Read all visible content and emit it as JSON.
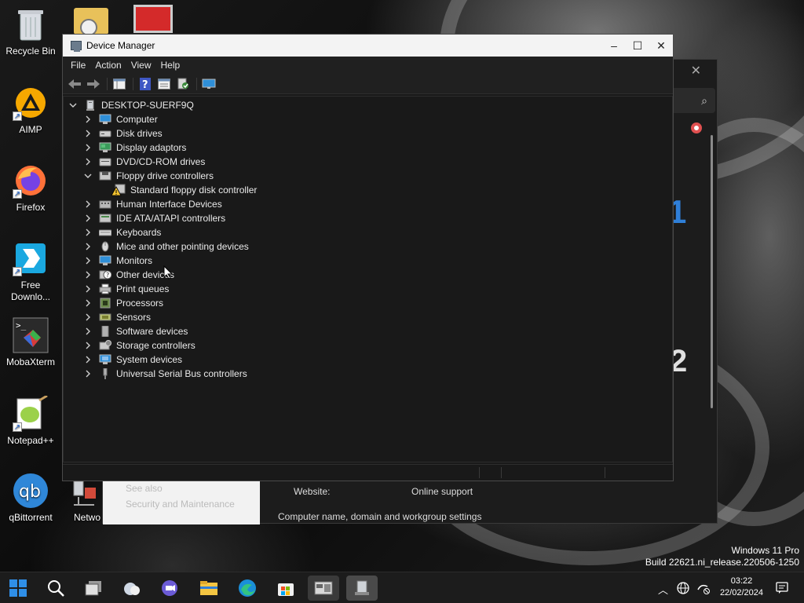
{
  "desktop": {
    "icons": [
      {
        "label": "Recycle Bin",
        "icon": "recycle-bin-icon"
      },
      {
        "label": "AIMP",
        "icon": "aimp-icon"
      },
      {
        "label": "Firefox",
        "icon": "firefox-icon"
      },
      {
        "label": "Free Downlo...",
        "icon": "free-download-manager-icon"
      },
      {
        "label": "MobaXterm",
        "icon": "mobaxterm-icon"
      },
      {
        "label": "Notepad++",
        "icon": "notepadpp-icon"
      },
      {
        "label": "qBittorrent",
        "icon": "qbittorrent-icon"
      },
      {
        "label": "Netwo",
        "icon": "network-icon"
      }
    ]
  },
  "background_window": {
    "left_panel": [
      "See also",
      "Security and Maintenance"
    ],
    "website_label": "Website:",
    "website_value": "Online support",
    "computer_name_section": "Computer name, domain and workgroup settings",
    "big_text_1": "1",
    "big_text_2": "2"
  },
  "device_manager": {
    "title": "Device Manager",
    "window_controls": {
      "minimize": "–",
      "maximize": "☐",
      "close": "✕"
    },
    "menu": [
      "File",
      "Action",
      "View",
      "Help"
    ],
    "root": "DESKTOP-SUERF9Q",
    "categories": [
      {
        "label": "Computer",
        "expanded": false,
        "icon": "computer-icon"
      },
      {
        "label": "Disk drives",
        "expanded": false,
        "icon": "disk-drive-icon"
      },
      {
        "label": "Display adaptors",
        "expanded": false,
        "icon": "display-adapter-icon"
      },
      {
        "label": "DVD/CD-ROM drives",
        "expanded": false,
        "icon": "dvd-drive-icon"
      },
      {
        "label": "Floppy drive controllers",
        "expanded": true,
        "icon": "floppy-controller-icon",
        "children": [
          {
            "label": "Standard floppy disk controller",
            "icon": "warning-device-icon"
          }
        ]
      },
      {
        "label": "Human Interface Devices",
        "expanded": false,
        "icon": "hid-icon"
      },
      {
        "label": "IDE ATA/ATAPI controllers",
        "expanded": false,
        "icon": "ide-controller-icon"
      },
      {
        "label": "Keyboards",
        "expanded": false,
        "icon": "keyboard-icon"
      },
      {
        "label": "Mice and other pointing devices",
        "expanded": false,
        "icon": "mouse-icon"
      },
      {
        "label": "Monitors",
        "expanded": false,
        "icon": "monitor-icon"
      },
      {
        "label": "Other devices",
        "expanded": false,
        "icon": "other-devices-icon"
      },
      {
        "label": "Print queues",
        "expanded": false,
        "icon": "printer-icon"
      },
      {
        "label": "Processors",
        "expanded": false,
        "icon": "processor-icon"
      },
      {
        "label": "Sensors",
        "expanded": false,
        "icon": "sensor-icon"
      },
      {
        "label": "Software devices",
        "expanded": false,
        "icon": "software-device-icon"
      },
      {
        "label": "Storage controllers",
        "expanded": false,
        "icon": "storage-controller-icon"
      },
      {
        "label": "System devices",
        "expanded": false,
        "icon": "system-device-icon"
      },
      {
        "label": "Universal Serial Bus controllers",
        "expanded": false,
        "icon": "usb-icon"
      }
    ]
  },
  "taskbar": {
    "items": [
      "start-icon",
      "search-icon",
      "task-view-icon",
      "widgets-icon",
      "chat-icon",
      "file-explorer-icon",
      "edge-icon",
      "store-icon",
      "system-control-panel-icon",
      "device-manager-icon"
    ],
    "time": "03:22",
    "date": "22/02/2024"
  },
  "watermark": {
    "line1": "Windows 11 Pro",
    "line2": "Build 22621.ni_release.220506-1250"
  },
  "colors": {
    "accent": "#2f7fd8",
    "titlebar": "#f3f3f3",
    "window_bg": "#191919"
  }
}
